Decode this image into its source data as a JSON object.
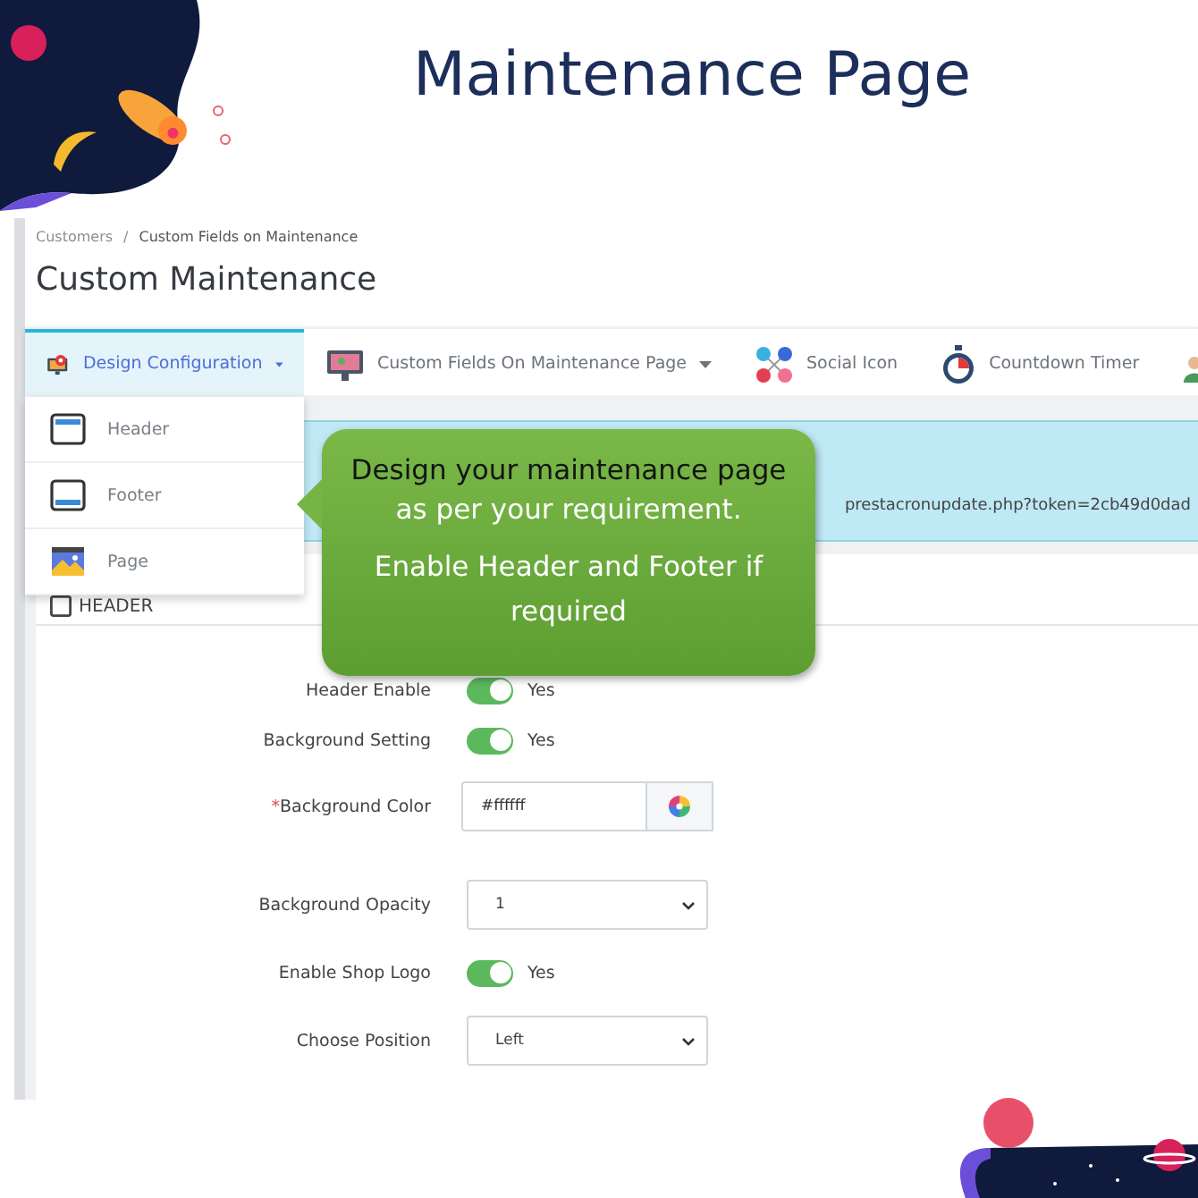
{
  "banner": {
    "title": "Maintenance Page"
  },
  "breadcrumb": {
    "items": [
      "Customers",
      "Custom Fields on Maintenance"
    ],
    "separator": "/"
  },
  "page_title": "Custom Maintenance",
  "tabs": [
    {
      "label": "Design Configuration",
      "caret": true,
      "selected": true
    },
    {
      "label": "Custom Fields On Maintenance Page",
      "caret": true,
      "selected": false
    },
    {
      "label": "Social Icon",
      "caret": false,
      "selected": false
    },
    {
      "label": "Countdown Timer",
      "caret": false,
      "selected": false
    },
    {
      "caret": false,
      "selected": false
    }
  ],
  "dropdown": [
    {
      "label": "Header"
    },
    {
      "label": "Footer"
    },
    {
      "label": "Page"
    }
  ],
  "alert": {
    "text": "prestacronupdate.php?token=2cb49d0dad"
  },
  "panel": {
    "heading": "HEADER",
    "required_mark": "*",
    "rows": [
      {
        "label": "Header Enable",
        "kind": "toggle",
        "on": true,
        "value": "Yes",
        "required": false
      },
      {
        "label": "Background Setting",
        "kind": "toggle",
        "on": true,
        "value": "Yes",
        "required": false
      },
      {
        "label": "Background Color",
        "kind": "color",
        "value": "#ffffff",
        "required": true
      },
      {
        "label": "Background Opacity",
        "kind": "select",
        "value": "1",
        "required": false
      },
      {
        "label": "Enable Shop Logo",
        "kind": "toggle",
        "on": true,
        "value": "Yes",
        "required": false
      },
      {
        "label": "Choose Position",
        "kind": "select",
        "value": "Left",
        "required": false
      }
    ]
  },
  "callout": {
    "lines": [
      {
        "text": "Design your maintenance page",
        "emphasis": true
      },
      {
        "text": "as per your requirement.",
        "emphasis": false
      },
      {
        "text": "Enable Header and Footer if required",
        "emphasis": false
      }
    ]
  }
}
